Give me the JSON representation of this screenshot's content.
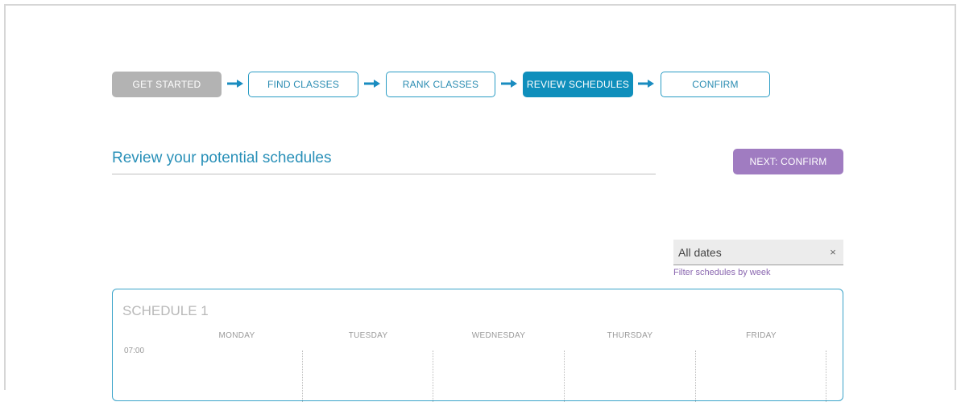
{
  "stepper": {
    "steps": [
      {
        "label": "GET STARTED",
        "state": "done"
      },
      {
        "label": "FIND CLASSES",
        "state": "pending"
      },
      {
        "label": "RANK CLASSES",
        "state": "pending"
      },
      {
        "label": "REVIEW SCHEDULES",
        "state": "active"
      },
      {
        "label": "CONFIRM",
        "state": "pending"
      }
    ],
    "arrow_icon": "arrow-right-icon"
  },
  "header": {
    "title": "Review your potential schedules",
    "next_button": "NEXT: CONFIRM"
  },
  "filter": {
    "value": "All dates",
    "clear_icon": "×",
    "help": "Filter schedules by week"
  },
  "schedule": {
    "title": "SCHEDULE 1",
    "days": [
      "MONDAY",
      "TUESDAY",
      "WEDNESDAY",
      "THURSDAY",
      "FRIDAY"
    ],
    "first_time": "07:00"
  },
  "colors": {
    "accent": "#0f8fbc",
    "purple": "#a07cc1",
    "done": "#b3b3b3"
  }
}
